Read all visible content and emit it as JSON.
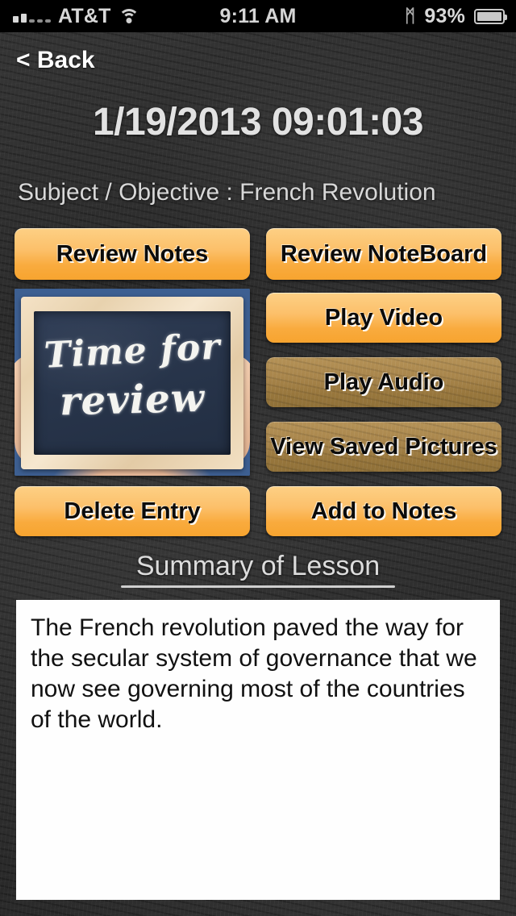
{
  "statusbar": {
    "carrier": "AT&T",
    "signal_icon": "signal-bars-icon",
    "wifi_icon": "wifi-icon",
    "time": "9:11 AM",
    "bluetooth_icon": "bluetooth-icon",
    "bluetooth_glyph": "ᛗ",
    "battery_percent": "93%",
    "battery_icon": "battery-icon"
  },
  "nav": {
    "back_label": "< Back"
  },
  "header": {
    "datetime": "1/19/2013 09:01:03",
    "subject": "Subject / Objective : French Revolution"
  },
  "buttons": {
    "review_notes": "Review Notes",
    "review_noteboard": "Review NoteBoard",
    "play_video": "Play Video",
    "play_audio": "Play Audio",
    "view_saved_pictures": "View Saved Pictures",
    "delete_entry": "Delete Entry",
    "add_to_notes": "Add to Notes"
  },
  "thumbnail": {
    "name": "lesson-thumbnail-image",
    "chalk_line1": "Time for",
    "chalk_line2": "review"
  },
  "summary": {
    "title": "Summary of Lesson",
    "text": "The French revolution paved the way for the secular system of governance that we now see governing most of the countries of the world."
  },
  "colors": {
    "button_active_top": "#fdd085",
    "button_active_bottom": "#f7a42f",
    "button_disabled": "#a8854b",
    "chalkboard": "#2f2f2f",
    "text_light": "#dcdcdc",
    "summary_bg": "#fefefe"
  }
}
